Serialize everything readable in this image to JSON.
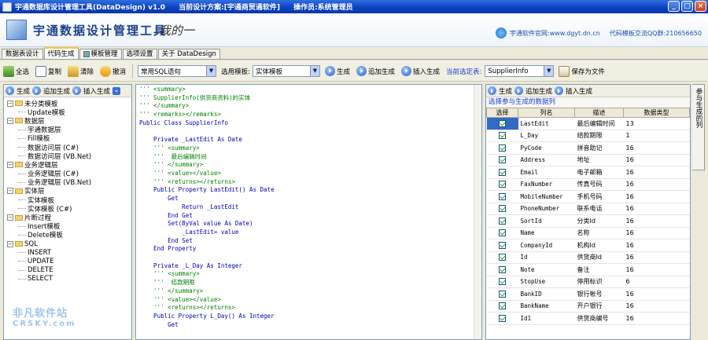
{
  "window": {
    "title_app": "宇通数据库设计管理工具(DataDesign) v1.0",
    "title_scheme": "当前设计方案:[宇通商贸通软件]",
    "title_operator": "操作员:系统管理员"
  },
  "banner": {
    "brand": "宇通数据设计管理工具",
    "signature": "我的一",
    "site": "宇通软件官网:www.dgyt.dn.cn",
    "qq": "代码模板交流QQ群:210656650"
  },
  "main_tabs": [
    "数据表设计",
    "代码生成",
    "模板管理",
    "选项设置",
    "关于 DataDesign"
  ],
  "toolbar": {
    "select_all": "全选",
    "copy": "复制",
    "clear": "清除",
    "undo": "撤消",
    "sql_combo": "常用SQL语句",
    "template_label": "选用模板:",
    "template_value": "实体模板",
    "generate": "生成",
    "append_generate": "追加生成",
    "insert_generate": "插入生成",
    "current_table_label": "当前选定表:",
    "current_table_value": "SupplierInfo",
    "save_file": "保存为文件"
  },
  "left_panel": {
    "generate": "生成",
    "append_generate": "追加生成",
    "insert_generate": "插入生成",
    "tree": [
      {
        "label": "未分类模板",
        "children": [
          "Update模板"
        ]
      },
      {
        "label": "数据层",
        "children": [
          "宇通数据层",
          "Fill模板",
          "数据访问层 (C#)",
          "数据访问层 (VB.Net)"
        ]
      },
      {
        "label": "业务逻辑层",
        "children": [
          "业务逻辑层 (C#)",
          "业务逻辑层 (VB.Net)"
        ]
      },
      {
        "label": "实体层",
        "children": [
          "实体模板",
          "实体模板 (C#)"
        ]
      },
      {
        "label": "片断过程",
        "children": [
          "Insert模板",
          "Delete模板"
        ]
      },
      {
        "label": "SQL",
        "children": [
          "INSERT",
          "UPDATE",
          "DELETE",
          "SELECT"
        ]
      }
    ]
  },
  "code_lines": [
    [
      "c",
      "''' <summary>"
    ],
    [
      "c",
      "''' SupplierInfo(供货商资料)的实体"
    ],
    [
      "c",
      "''' </summary>"
    ],
    [
      "c",
      "''' <remarks></remarks>"
    ],
    [
      "k",
      "Public Class SupplierInfo"
    ],
    [
      "n",
      ""
    ],
    [
      "k",
      "    Private _LastEdit As Date"
    ],
    [
      "c",
      "    ''' <summary>"
    ],
    [
      "c",
      "    '''  最后编辑时间"
    ],
    [
      "c",
      "    ''' </summary>"
    ],
    [
      "c",
      "    ''' <value></value>"
    ],
    [
      "c",
      "    ''' <returns></returns>"
    ],
    [
      "k",
      "    Public Property LastEdit() As Date"
    ],
    [
      "k",
      "        Get"
    ],
    [
      "k",
      "            Return _LastEdit"
    ],
    [
      "k",
      "        End Get"
    ],
    [
      "k",
      "        Set(ByVal value As Date)"
    ],
    [
      "k",
      "            _LastEdit= value"
    ],
    [
      "k",
      "        End Set"
    ],
    [
      "k",
      "    End Property"
    ],
    [
      "n",
      ""
    ],
    [
      "k",
      "    Private _L_Day As Integer"
    ],
    [
      "c",
      "    ''' <summary>"
    ],
    [
      "c",
      "    '''  结款期限"
    ],
    [
      "c",
      "    ''' </summary>"
    ],
    [
      "c",
      "    ''' <value></value>"
    ],
    [
      "c",
      "    ''' <returns></returns>"
    ],
    [
      "k",
      "    Public Property L_Day() As Integer"
    ],
    [
      "k",
      "        Get"
    ]
  ],
  "right_panel": {
    "generate": "生成",
    "append_generate": "追加生成",
    "insert_generate": "插入生成",
    "hint": "选择参与生成的数据列",
    "headers": [
      "选择",
      "列名",
      "描述",
      "数据类型"
    ],
    "rows": [
      [
        "LastEdit",
        "最后编辑时间",
        "13"
      ],
      [
        "L_Day",
        "结款期限",
        "1"
      ],
      [
        "PyCode",
        "拼音助记",
        "16"
      ],
      [
        "Address",
        "地址",
        "16"
      ],
      [
        "Email",
        "电子邮箱",
        "16"
      ],
      [
        "FaxNumber",
        "传真号码",
        "16"
      ],
      [
        "MobileNumber",
        "手机号码",
        "16"
      ],
      [
        "PhoneNumber",
        "联系电话",
        "16"
      ],
      [
        "SortId",
        "分类Id",
        "16"
      ],
      [
        "Name",
        "名称",
        "16"
      ],
      [
        "CompanyId",
        "机构Id",
        "16"
      ],
      [
        "Id",
        "供货商Id",
        "16"
      ],
      [
        "Note",
        "备注",
        "16"
      ],
      [
        "StopUse",
        "停用标识",
        "6"
      ],
      [
        "BankID",
        "银行帐号",
        "16"
      ],
      [
        "BankName",
        "开户银行",
        "16"
      ],
      [
        "Id1",
        "供货商编号",
        "16"
      ]
    ]
  },
  "side_tab": "参与生成的列",
  "watermark": {
    "line1": "非凡软件站",
    "line2": "CRSKY.com"
  }
}
